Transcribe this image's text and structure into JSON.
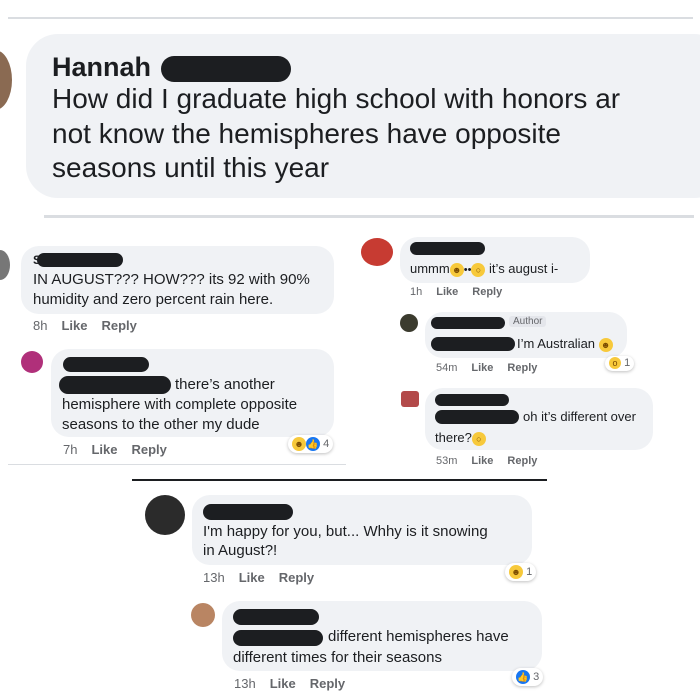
{
  "main_post": {
    "name": "Hannah",
    "text_line1": "How did I graduate high school with honors ar",
    "text_line2": "not know the hemispheres have opposite",
    "text_line3": "seasons until this year"
  },
  "left_thread": {
    "comment1": {
      "initial": "S",
      "text_line1": "IN AUGUST??? HOW??? its 92 with 90%",
      "text_line2": "humidity and zero percent rain here.",
      "time": "8h",
      "like": "Like",
      "reply": "Reply"
    },
    "comment2": {
      "text_line1": "there’s another",
      "text_line2": "hemisphere with complete opposite",
      "text_line3": "seasons to the other my dude",
      "time": "7h",
      "like": "Like",
      "reply": "Reply",
      "reaction_count": "4"
    }
  },
  "right_thread": {
    "comment1": {
      "text_pre": "ummm",
      "text_post": "it’s august i-",
      "time": "1h",
      "like": "Like",
      "reply": "Reply"
    },
    "comment2": {
      "author_badge": "Author",
      "text": "I’m Australian",
      "time": "54m",
      "like": "Like",
      "reply": "Reply",
      "reaction_count": "1"
    },
    "comment3": {
      "text_line1": "oh it’s different over",
      "text_line2": "there?",
      "time": "53m",
      "like": "Like",
      "reply": "Reply"
    }
  },
  "bottom_thread": {
    "comment1": {
      "text_line1": "I'm happy for you, but... Whhy is it snowing",
      "text_line2": "in August?!",
      "time": "13h",
      "like": "Like",
      "reply": "Reply",
      "reaction_count": "1"
    },
    "comment2": {
      "text_line1": "different hemispheres have",
      "text_line2": "different times for their seasons",
      "time": "13h",
      "like": "Like",
      "reply": "Reply",
      "reaction_count": "3"
    }
  },
  "colors": {
    "bubble": "#f0f2f5",
    "redaction": "#1c1e21",
    "like_blue": "#1877f2",
    "emoji_yellow": "#f7c93b"
  }
}
